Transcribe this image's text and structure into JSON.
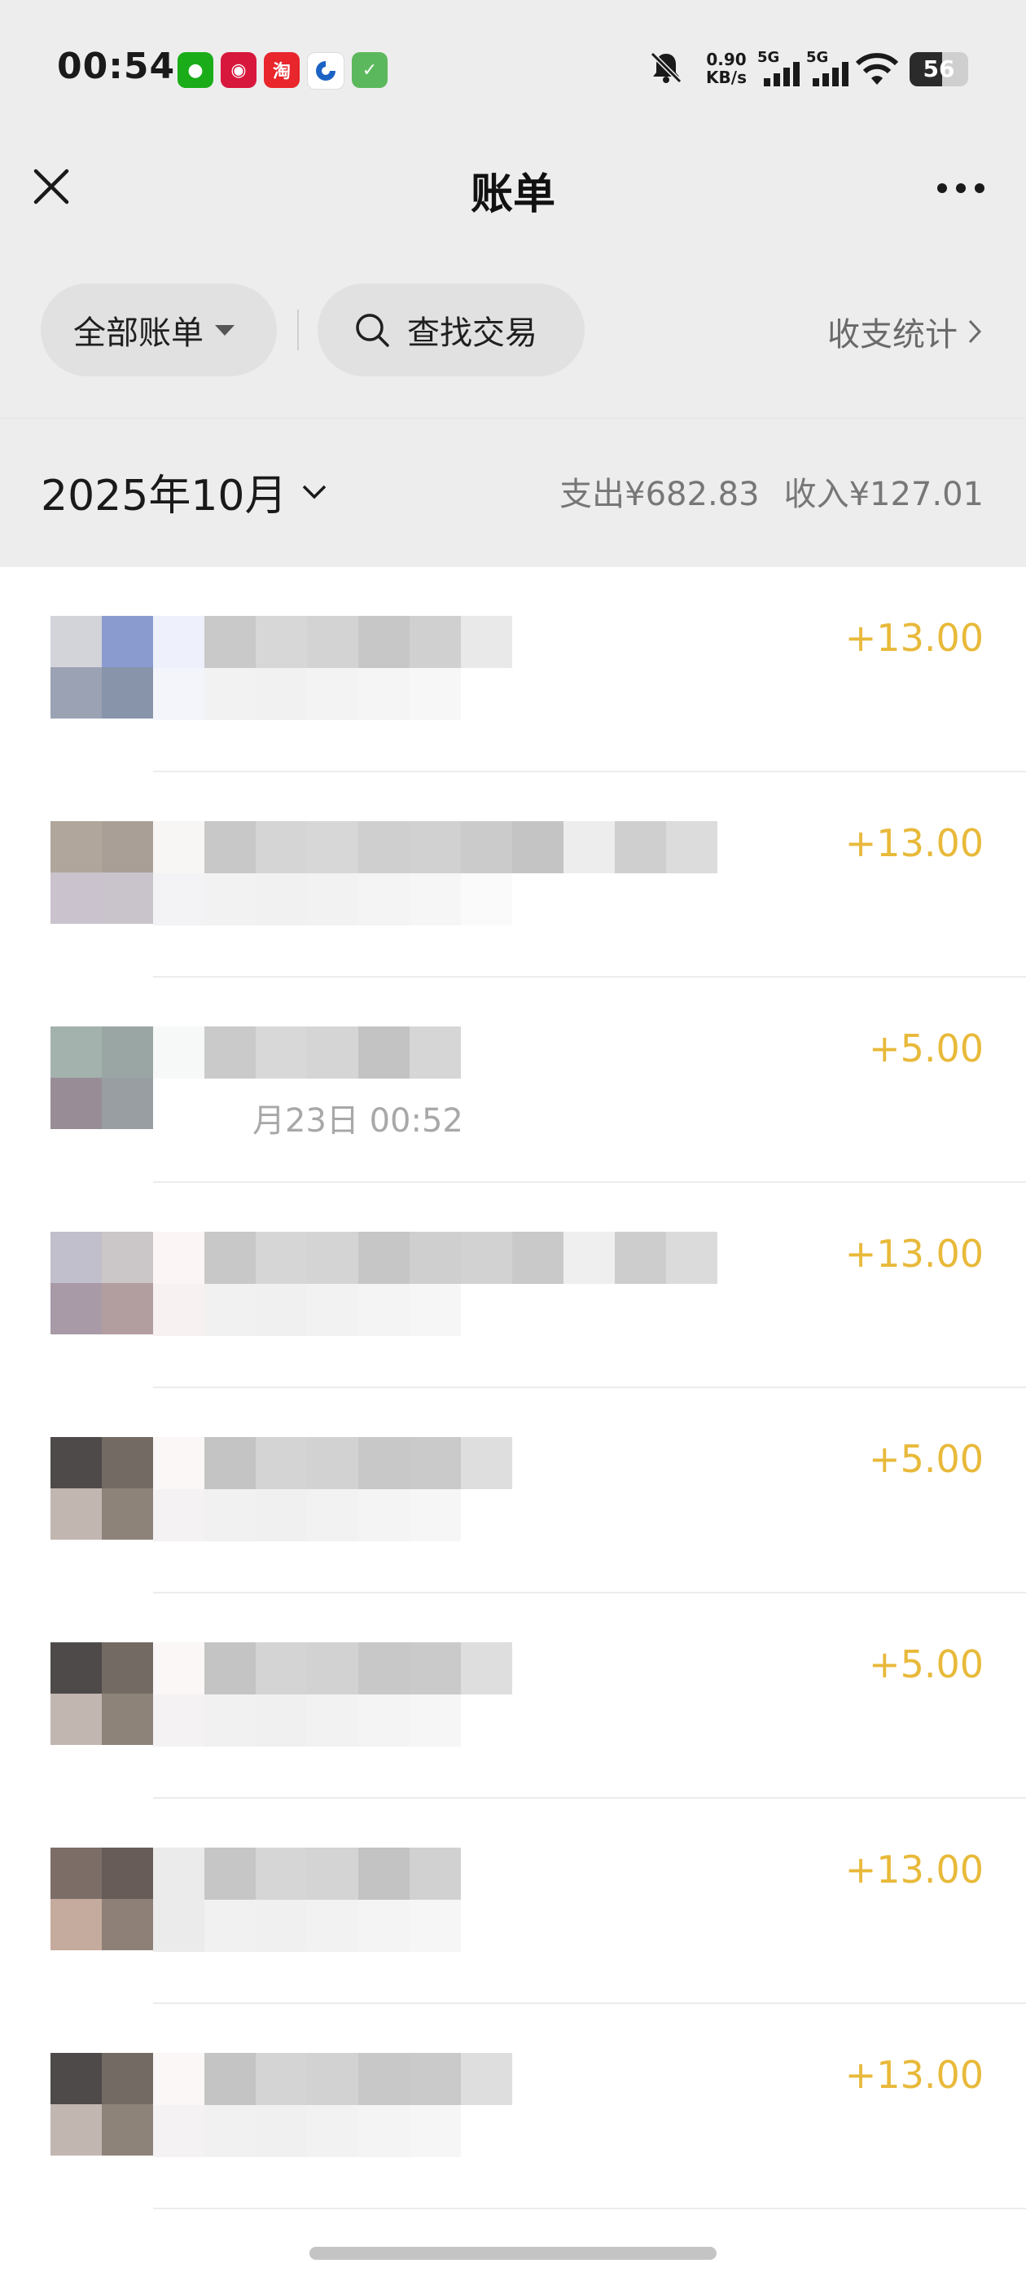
{
  "status_bar": {
    "time": "00:54",
    "net_speed_value": "0.90",
    "net_speed_unit": "KB/s",
    "signal_1_label": "5G",
    "signal_2_label": "5G",
    "battery": "56",
    "app_icons": [
      "wechat-icon",
      "tmall-icon",
      "taobao-icon",
      "bank-icon",
      "check-icon"
    ]
  },
  "header": {
    "title": "账单"
  },
  "filters": {
    "all_bills": "全部账单",
    "search": "查找交易",
    "stats": "收支统计"
  },
  "month": {
    "label": "2025年10月",
    "expense": "支出¥682.83",
    "income": "收入¥127.01"
  },
  "transactions": [
    {
      "amount": "+13.00",
      "time": ""
    },
    {
      "amount": "+13.00",
      "time": ""
    },
    {
      "amount": "+5.00",
      "time": "月23日 00:52"
    },
    {
      "amount": "+13.00",
      "time": ""
    },
    {
      "amount": "+5.00",
      "time": ""
    },
    {
      "amount": "+5.00",
      "time": ""
    },
    {
      "amount": "+13.00",
      "time": ""
    },
    {
      "amount": "+13.00",
      "time": ""
    }
  ],
  "colors": {
    "income_amount": "#e8b93a",
    "background_header": "#ededed"
  }
}
